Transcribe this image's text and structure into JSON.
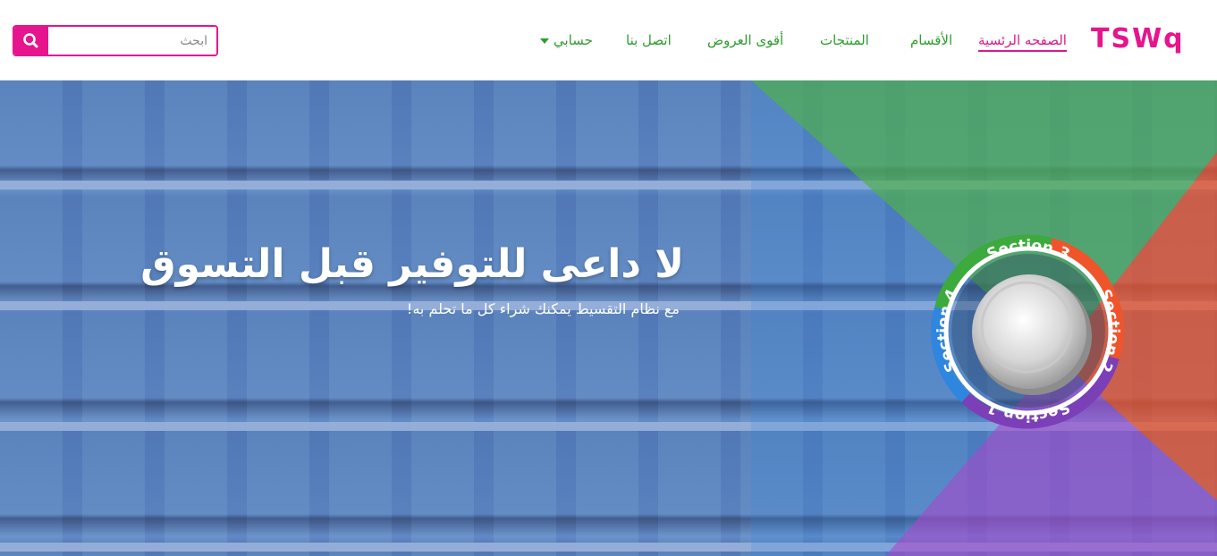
{
  "brand": {
    "logo_text": "TSWq",
    "accent": "#e6158e",
    "link_color": "#2e9e2e"
  },
  "nav": {
    "home": "الصفحه الرئسية",
    "categories": "الأقسام",
    "products": "المنتجات",
    "offers": "أقوى العروض",
    "contact": "اتصل بنا",
    "account": "حسابي"
  },
  "search": {
    "placeholder": "ابحث",
    "value": "",
    "icon": "search-icon"
  },
  "hero": {
    "title": "لا داعى للتوفير قبل التسوق",
    "subtitle": "مع نظام التقسيط يمكنك شراء كل ما تحلم به!"
  },
  "wheel": {
    "sections": [
      "Section 1",
      "Section 2",
      "Section 3",
      "Section 4"
    ],
    "colors": {
      "section1": "#7b3fb8",
      "section2": "#f0542a",
      "section3": "#3caa3c",
      "section4": "#2e86de"
    }
  }
}
